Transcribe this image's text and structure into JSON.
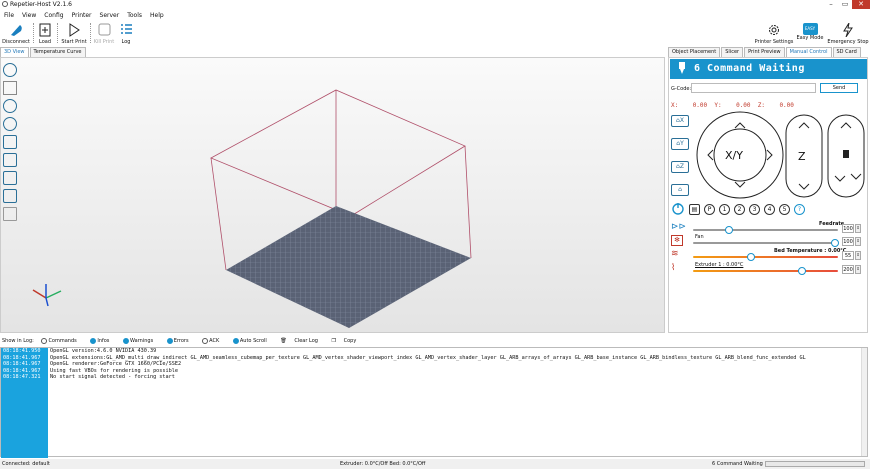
{
  "window": {
    "title": "Repetier-Host V2.1.6"
  },
  "menu": [
    "File",
    "View",
    "Config",
    "Printer",
    "Server",
    "Tools",
    "Help"
  ],
  "toolbar": {
    "disconnect": "Disconnect",
    "load": "Load",
    "start_print": "Start Print",
    "kill_print": "Kill Print",
    "log": "Log",
    "printer_settings": "Printer Settings",
    "easy_mode": "Easy Mode",
    "easy_badge": "EASY",
    "emergency_stop": "Emergency Stop"
  },
  "view_tabs": [
    "3D View",
    "Temperature Curve"
  ],
  "right_tabs": [
    "Object Placement",
    "Slicer",
    "Print Preview",
    "Manual Control",
    "SD Card"
  ],
  "manual": {
    "status": "6 Command Waiting",
    "gcode_label": "G-Code:",
    "send": "Send",
    "x_label": "X:",
    "x_val": "0.00",
    "y_label": "Y:",
    "y_val": "0.00",
    "z_label": "Z:",
    "z_val": "0.00",
    "home_x": "X",
    "home_y": "Y",
    "home_z": "Z",
    "xy": "X/Y",
    "z": "Z",
    "feedrate_label": "Feedrate",
    "feedrate_val": "100",
    "fan_label": "Fan",
    "fan_val": "100",
    "bed_label": "Bed Temperature : 0.00°C",
    "bed_val": "55",
    "ext_label": "Extruder 1 : 0.00°C",
    "ext_val": "200",
    "macro_buttons": [
      "P",
      "1",
      "2",
      "3",
      "4",
      "5",
      "?"
    ],
    "feedrate_pct": 0.25,
    "fan_pct": 0.98,
    "bed_pct": 0.4,
    "ext_pct": 0.75
  },
  "log_bar": {
    "show_in_log": "Show in Log:",
    "commands": "Commands",
    "infos": "Infos",
    "warnings": "Warnings",
    "errors": "Errors",
    "ack": "ACK",
    "auto_scroll": "Auto Scroll",
    "clear_log": "Clear Log",
    "copy": "Copy"
  },
  "log": [
    {
      "time": "08:18:41.950",
      "msg": "OpenGL version:4.6.0 NVIDIA 430.39"
    },
    {
      "time": "08:18:41.967",
      "msg": "OpenGL extensions:GL_AMD_multi_draw_indirect GL_AMD_seamless_cubemap_per_texture GL_AMD_vertex_shader_viewport_index GL_AMD_vertex_shader_layer GL_ARB_arrays_of_arrays GL_ARB_base_instance GL_ARB_bindless_texture GL_ARB_blend_func_extended GL"
    },
    {
      "time": "08:18:41.967",
      "msg": "OpenGL renderer:GeForce GTX 1660/PCIe/SSE2"
    },
    {
      "time": "08:18:41.967",
      "msg": "Using fast VBOs for rendering is possible"
    },
    {
      "time": "08:18:47.321",
      "msg": "No start signal detected - forcing start"
    }
  ],
  "status": {
    "left": "Connected: default",
    "center": "Extruder: 0.0°C/Off Bed: 0.0°C/Off",
    "right": "6 Command Waiting"
  },
  "colors": {
    "accent": "#1993cc",
    "bed": "#5a6275",
    "frame": "#b0506a"
  }
}
